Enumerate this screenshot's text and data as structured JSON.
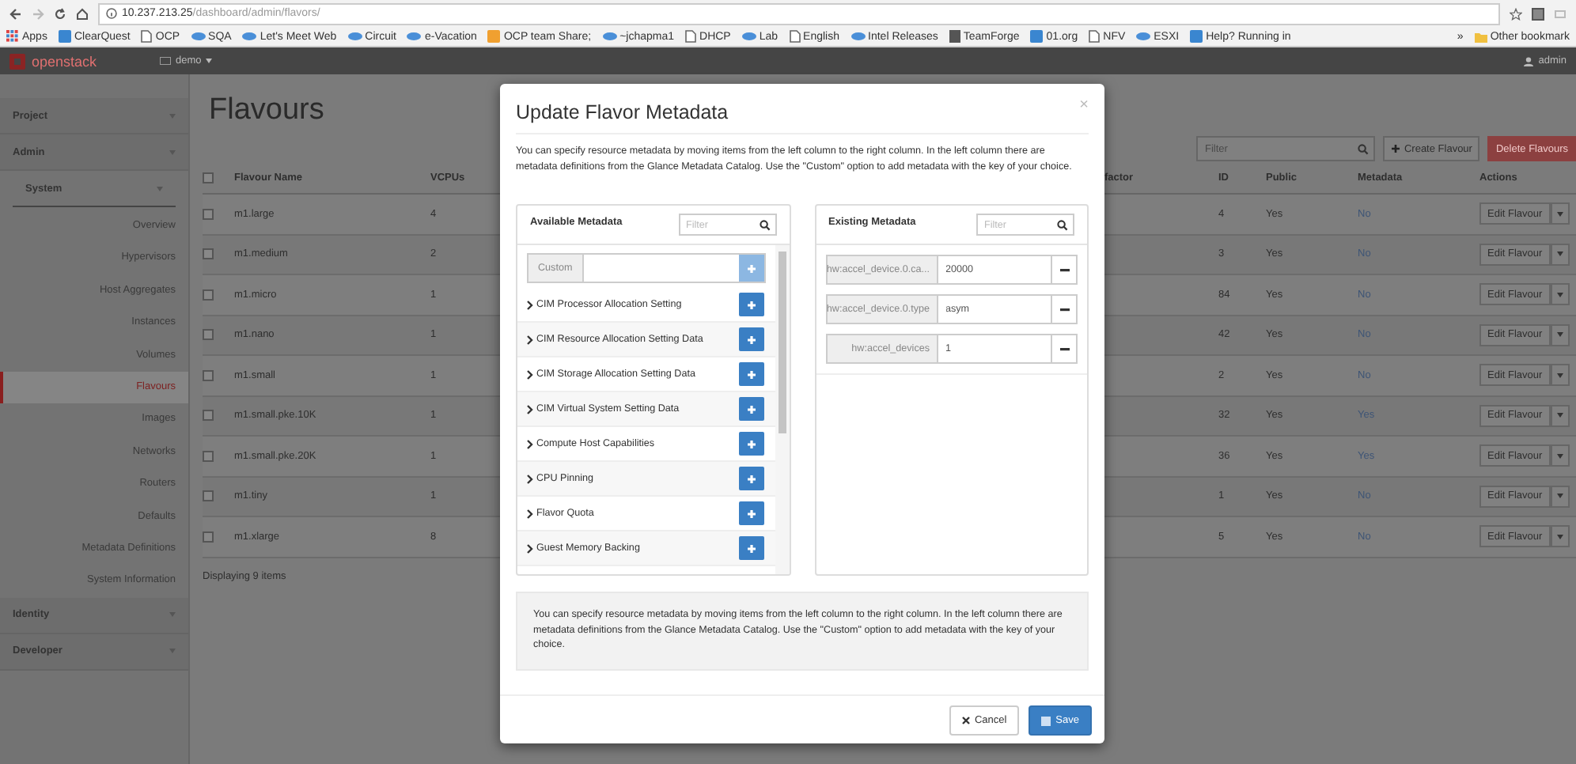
{
  "browser": {
    "url_host": "10.237.213.25",
    "url_path": "/dashboard/admin/flavors/",
    "bookmarks": [
      {
        "label": "Apps",
        "kind": "apps"
      },
      {
        "label": "ClearQuest",
        "kind": "bluetile"
      },
      {
        "label": "OCP",
        "kind": "page"
      },
      {
        "label": "SQA",
        "kind": "link"
      },
      {
        "label": "Let's Meet Web",
        "kind": "link"
      },
      {
        "label": "Circuit",
        "kind": "link"
      },
      {
        "label": "e-Vacation",
        "kind": "link"
      },
      {
        "label": "OCP team Share;",
        "kind": "orangetile"
      },
      {
        "label": "~jchapma1",
        "kind": "link"
      },
      {
        "label": "DHCP",
        "kind": "page"
      },
      {
        "label": "Lab",
        "kind": "link"
      },
      {
        "label": "English",
        "kind": "page"
      },
      {
        "label": "Intel Releases",
        "kind": "link"
      },
      {
        "label": "TeamForge",
        "kind": "book"
      },
      {
        "label": "01.org",
        "kind": "bluetile"
      },
      {
        "label": "NFV",
        "kind": "page"
      },
      {
        "label": "ESXI",
        "kind": "link"
      },
      {
        "label": "Help? Running in",
        "kind": "bluetile"
      }
    ],
    "overflow": "»",
    "other_bookmarks": "Other bookmark"
  },
  "top_nav": {
    "logo": "openstack",
    "project": "demo",
    "user": "admin"
  },
  "sidebar": {
    "items": [
      {
        "label": "Project"
      },
      {
        "label": "Admin",
        "children": [
          {
            "label": "System",
            "children": [
              {
                "label": "Overview",
                "selected": false
              },
              {
                "label": "Hypervisors",
                "selected": false
              },
              {
                "label": "Host Aggregates",
                "selected": false
              },
              {
                "label": "Instances",
                "selected": false
              },
              {
                "label": "Volumes",
                "selected": false
              },
              {
                "label": "Flavours",
                "selected": true
              },
              {
                "label": "Images",
                "selected": false
              },
              {
                "label": "Networks",
                "selected": false
              },
              {
                "label": "Routers",
                "selected": false
              },
              {
                "label": "Defaults",
                "selected": false
              },
              {
                "label": "Metadata Definitions",
                "selected": false
              },
              {
                "label": "System Information",
                "selected": false
              }
            ]
          }
        ]
      },
      {
        "label": "Identity"
      },
      {
        "label": "Developer"
      }
    ]
  },
  "page": {
    "title": "Flavours",
    "filter_placeholder": "Filter",
    "create_button": "Create Flavour",
    "delete_button": "Delete Flavours"
  },
  "table": {
    "header_checked": false,
    "columns": [
      "Flavour Name",
      "VCPUs",
      "factor",
      "ID",
      "Public",
      "Metadata",
      "Actions"
    ],
    "rows": [
      {
        "checked": false,
        "name": "m1.large",
        "vcpus": "4",
        "id": "4",
        "public": "Yes",
        "metadata": "No",
        "action": "Edit Flavour"
      },
      {
        "checked": false,
        "name": "m1.medium",
        "vcpus": "2",
        "id": "3",
        "public": "Yes",
        "metadata": "No",
        "action": "Edit Flavour"
      },
      {
        "checked": false,
        "name": "m1.micro",
        "vcpus": "1",
        "id": "84",
        "public": "Yes",
        "metadata": "No",
        "action": "Edit Flavour"
      },
      {
        "checked": false,
        "name": "m1.nano",
        "vcpus": "1",
        "id": "42",
        "public": "Yes",
        "metadata": "No",
        "action": "Edit Flavour"
      },
      {
        "checked": false,
        "name": "m1.small",
        "vcpus": "1",
        "id": "2",
        "public": "Yes",
        "metadata": "No",
        "action": "Edit Flavour"
      },
      {
        "checked": false,
        "name": "m1.small.pke.10K",
        "vcpus": "1",
        "id": "32",
        "public": "Yes",
        "metadata": "Yes",
        "action": "Edit Flavour"
      },
      {
        "checked": false,
        "name": "m1.small.pke.20K",
        "vcpus": "1",
        "id": "36",
        "public": "Yes",
        "metadata": "Yes",
        "action": "Edit Flavour"
      },
      {
        "checked": false,
        "name": "m1.tiny",
        "vcpus": "1",
        "id": "1",
        "public": "Yes",
        "metadata": "No",
        "action": "Edit Flavour"
      },
      {
        "checked": false,
        "name": "m1.xlarge",
        "vcpus": "8",
        "id": "5",
        "public": "Yes",
        "metadata": "No",
        "action": "Edit Flavour"
      }
    ],
    "footer": "Displaying 9 items"
  },
  "modal": {
    "title": "Update Flavor Metadata",
    "close": "×",
    "description": "You can specify resource metadata by moving items from the left column to the right column. In the left column there are metadata definitions from the Glance Metadata Catalog. Use the \"Custom\" option to add metadata with the key of your choice.",
    "available": {
      "title": "Available Metadata",
      "filter_placeholder": "Filter",
      "custom_label": "Custom",
      "items": [
        "CIM Processor Allocation Setting",
        "CIM Resource Allocation Setting Data",
        "CIM Storage Allocation Setting Data",
        "CIM Virtual System Setting Data",
        "Compute Host Capabilities",
        "CPU Pinning",
        "Flavor Quota",
        "Guest Memory Backing"
      ]
    },
    "existing": {
      "title": "Existing Metadata",
      "filter_placeholder": "Filter",
      "items": [
        {
          "key": "hw:accel_device.0.ca...",
          "value": "20000"
        },
        {
          "key": "hw:accel_device.0.type",
          "value": "asym"
        },
        {
          "key": "hw:accel_devices",
          "value": "1"
        }
      ]
    },
    "help": "You can specify resource metadata by moving items from the left column to the right column. In the left column there are metadata definitions from the Glance Metadata Catalog. Use the \"Custom\" option to add metadata with the key of your choice.",
    "cancel": "Cancel",
    "save": "Save"
  }
}
